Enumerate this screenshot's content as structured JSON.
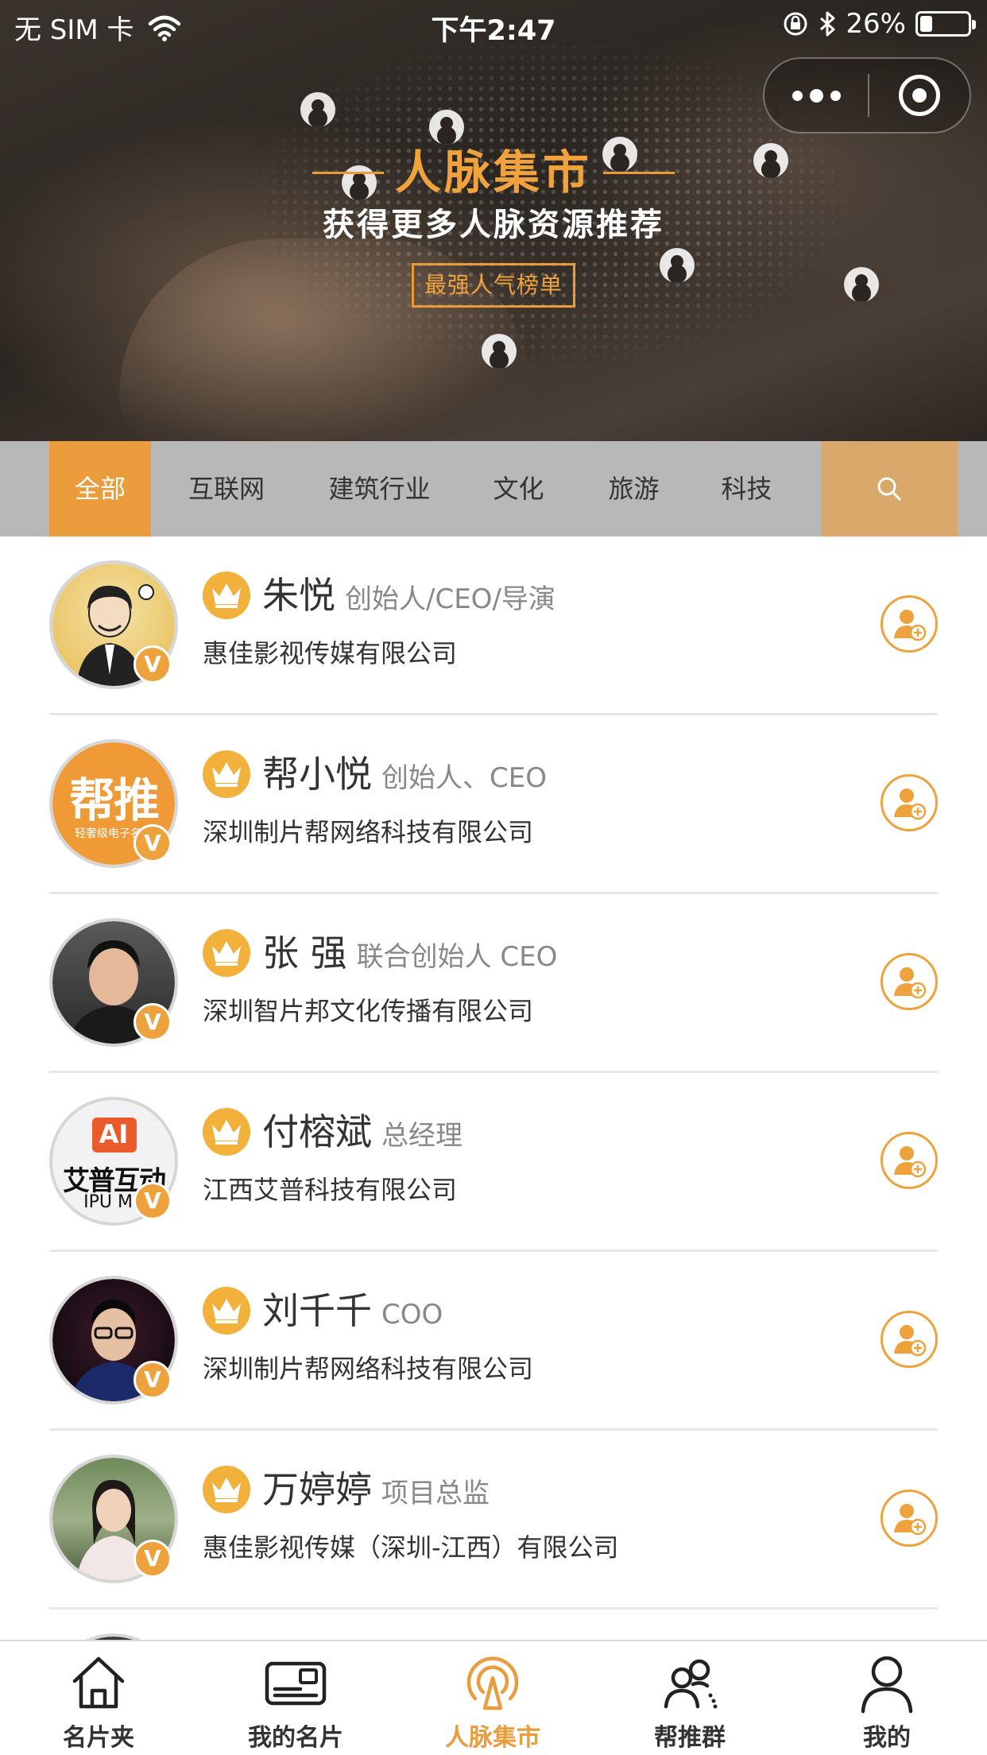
{
  "status_bar": {
    "carrier": "无 SIM 卡",
    "time": "下午2:47",
    "battery_percent": "26%",
    "battery_level": 0.26
  },
  "banner": {
    "title": "人脉集市",
    "subtitle": "获得更多人脉资源推荐",
    "badge": "最强人气榜单"
  },
  "tabs": [
    {
      "label": "全部",
      "active": true
    },
    {
      "label": "互联网",
      "active": false
    },
    {
      "label": "建筑行业",
      "active": false
    },
    {
      "label": "文化",
      "active": false
    },
    {
      "label": "旅游",
      "active": false
    },
    {
      "label": "科技",
      "active": false
    }
  ],
  "contacts": [
    {
      "name": "朱悦",
      "title": "创始人/CEO/导演",
      "company": "惠佳影视传媒有限公司",
      "verified": "V"
    },
    {
      "name": "帮小悦",
      "title": "创始人、CEO",
      "company": "深圳制片帮网络科技有限公司",
      "verified": "V",
      "avatar_text": "帮推",
      "avatar_subtext": "轻奢级电子名片"
    },
    {
      "name": "张 强",
      "title": "联合创始人 CEO",
      "company": "深圳智片邦文化传播有限公司",
      "verified": "V"
    },
    {
      "name": "付榕斌",
      "title": "总经理",
      "company": "江西艾普科技有限公司",
      "verified": "V",
      "avatar_text": "AI",
      "avatar_subtext": "艾普互动",
      "avatar_subtext2": "IPU ME"
    },
    {
      "name": "刘千千",
      "title": "COO",
      "company": "深圳制片帮网络科技有限公司",
      "verified": "V"
    },
    {
      "name": "万婷婷",
      "title": "项目总监",
      "company": "惠佳影视传媒（深圳-江西）有限公司",
      "verified": "V"
    }
  ],
  "bottom_nav": [
    {
      "label": "名片夹",
      "icon": "home-icon",
      "active": false
    },
    {
      "label": "我的名片",
      "icon": "card-icon",
      "active": false
    },
    {
      "label": "人脉集市",
      "icon": "broadcast-icon",
      "active": true
    },
    {
      "label": "帮推群",
      "icon": "group-icon",
      "active": false
    },
    {
      "label": "我的",
      "icon": "user-icon",
      "active": false
    }
  ],
  "colors": {
    "accent": "#eb9c3d",
    "tab_bar": "#b8b8b8",
    "search_tab": "#d9a86a",
    "crown": "#f2b13a"
  }
}
